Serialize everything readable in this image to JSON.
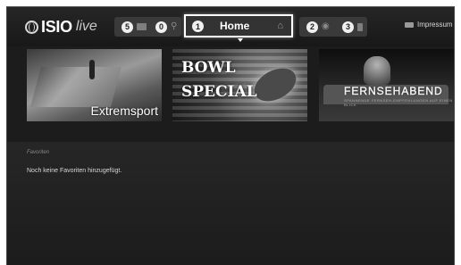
{
  "header": {
    "logo": {
      "brand": "ISIO",
      "suffix": "live"
    },
    "nav": [
      {
        "number": "5",
        "icon": "folder-icon"
      },
      {
        "number": "0",
        "icon": "search-icon"
      },
      {
        "number": "1",
        "label": "Home",
        "icon": "house-icon",
        "active": true
      },
      {
        "number": "2",
        "icon": "globe-icon"
      },
      {
        "number": "3",
        "icon": "trash-icon"
      }
    ],
    "impressum": {
      "label": "Impressum",
      "icon": "info-card-icon"
    }
  },
  "tiles": [
    {
      "caption": "Extremsport"
    },
    {
      "caption_line1": "BOWL",
      "caption_line2": "SPECIAL"
    },
    {
      "caption": "FERNSEHABEND",
      "subcaption": "SPANNENDE FERNSEH-EMPFEHLUNGEN AUF EINEN BLICK"
    }
  ],
  "favorites": {
    "label": "Favoriten",
    "empty_message": "Noch keine Favoriten hinzugefügt."
  },
  "colors": {
    "background": "#1c1c1c",
    "text": "#ffffff",
    "muted": "#888888"
  }
}
